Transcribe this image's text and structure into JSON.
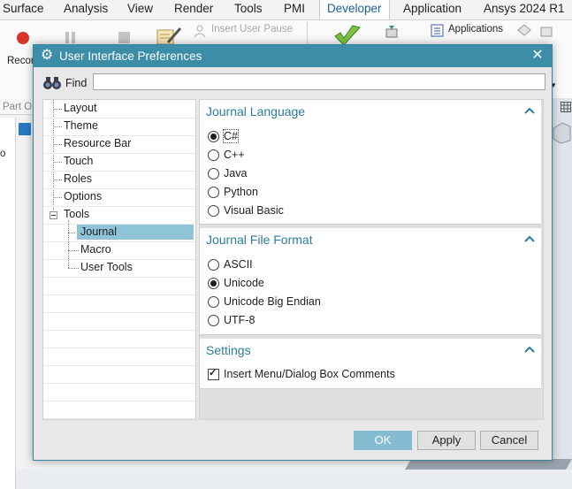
{
  "ribbon": {
    "tabs": [
      {
        "label": "Surface",
        "active": false
      },
      {
        "label": "Analysis",
        "active": false
      },
      {
        "label": "View",
        "active": false
      },
      {
        "label": "Render",
        "active": false
      },
      {
        "label": "Tools",
        "active": false
      },
      {
        "label": "PMI",
        "active": false
      },
      {
        "label": "Developer",
        "active": true
      },
      {
        "label": "Application",
        "active": false
      },
      {
        "label": "Ansys 2024 R1",
        "active": false
      }
    ],
    "record_label": "Recor",
    "insert_user_pause": "Insert User Pause",
    "applications": "Applications",
    "part_label": "Part O",
    "side_letter": "o"
  },
  "dialog": {
    "title": "User Interface Preferences",
    "close_glyph": "✕",
    "find_label": "Find",
    "find_value": "",
    "tree": [
      {
        "label": "Layout",
        "level": 1,
        "selected": false
      },
      {
        "label": "Theme",
        "level": 1,
        "selected": false
      },
      {
        "label": "Resource Bar",
        "level": 1,
        "selected": false
      },
      {
        "label": "Touch",
        "level": 1,
        "selected": false
      },
      {
        "label": "Roles",
        "level": 1,
        "selected": false
      },
      {
        "label": "Options",
        "level": 1,
        "selected": false
      },
      {
        "label": "Tools",
        "level": 1,
        "selected": false,
        "expanded": true
      },
      {
        "label": "Journal",
        "level": 2,
        "selected": true
      },
      {
        "label": "Macro",
        "level": 2,
        "selected": false
      },
      {
        "label": "User Tools",
        "level": 2,
        "selected": false
      }
    ],
    "journal_language": {
      "title": "Journal Language",
      "options": [
        "C#",
        "C++",
        "Java",
        "Python",
        "Visual Basic"
      ],
      "selected": "C#"
    },
    "journal_file_format": {
      "title": "Journal File Format",
      "options": [
        "ASCII",
        "Unicode",
        "Unicode Big Endian",
        "UTF-8"
      ],
      "selected": "Unicode"
    },
    "settings": {
      "title": "Settings",
      "checkbox_label": "Insert Menu/Dialog Box Comments",
      "checked": true
    },
    "buttons": {
      "ok": "OK",
      "apply": "Apply",
      "cancel": "Cancel"
    },
    "colors": {
      "title_bar": "#3b8da8",
      "selection": "#8ec3d8",
      "section_heading": "#2b7ca0",
      "ok_button": "#84bcd2"
    }
  }
}
